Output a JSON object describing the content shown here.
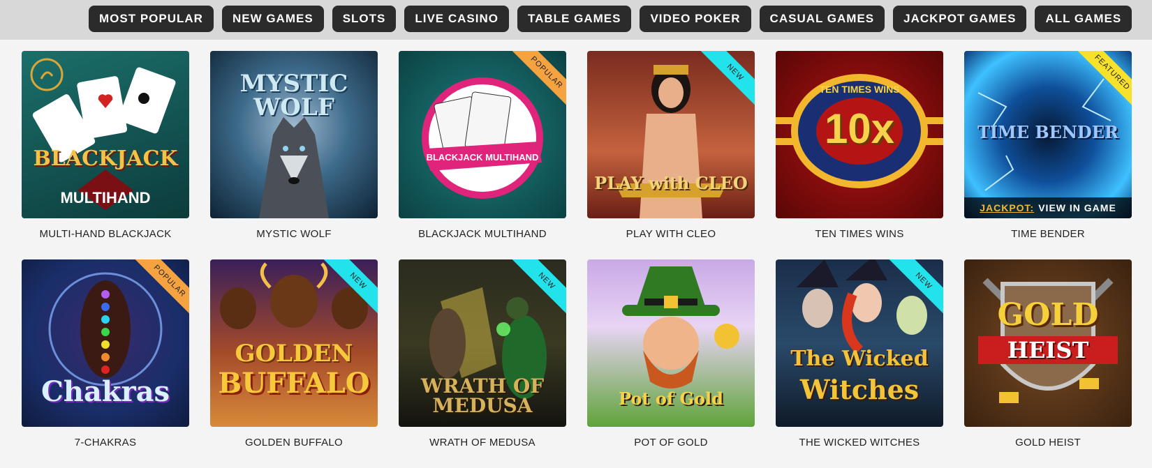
{
  "nav": [
    {
      "label": "MOST POPULAR"
    },
    {
      "label": "NEW GAMES"
    },
    {
      "label": "SLOTS"
    },
    {
      "label": "LIVE CASINO"
    },
    {
      "label": "TABLE GAMES"
    },
    {
      "label": "VIDEO POKER"
    },
    {
      "label": "CASUAL GAMES"
    },
    {
      "label": "JACKPOT GAMES"
    },
    {
      "label": "ALL GAMES"
    }
  ],
  "games": [
    {
      "name": "MULTI-HAND BLACKJACK",
      "art": "BLACKJACK",
      "art_sub": "MULTIHAND"
    },
    {
      "name": "MYSTIC WOLF",
      "art": "MYSTIC WOLF"
    },
    {
      "name": "BLACKJACK MULTIHAND",
      "art": "BLACKJACK MULTIHAND",
      "ribbon": "POPULAR"
    },
    {
      "name": "PLAY WITH CLEO",
      "art": "PLAY with CLEO",
      "ribbon": "NEW"
    },
    {
      "name": "TEN TIMES WINS",
      "art": "10x",
      "art_sub": "TEN TIMES WINS"
    },
    {
      "name": "TIME BENDER",
      "art": "TIME BENDER",
      "ribbon": "FEATURED",
      "jackpot_label": "JACKPOT:",
      "jackpot_value": "VIEW IN GAME"
    },
    {
      "name": "7-CHAKRAS",
      "art": "Chakras",
      "ribbon": "POPULAR"
    },
    {
      "name": "GOLDEN BUFFALO",
      "art": "GOLDEN",
      "art_sub": "BUFFALO",
      "ribbon": "NEW"
    },
    {
      "name": "WRATH OF MEDUSA",
      "art": "WRATH OF MEDUSA",
      "ribbon": "NEW"
    },
    {
      "name": "POT OF GOLD",
      "art": "Pot of Gold"
    },
    {
      "name": "THE WICKED WITCHES",
      "art": "The Wicked",
      "art_sub": "Witches",
      "ribbon": "NEW"
    },
    {
      "name": "GOLD HEIST",
      "art": "GOLD",
      "art_sub": "HEIST"
    }
  ],
  "colors": {
    "ribbon_popular": "#f5a340",
    "ribbon_new": "#22e3ec",
    "ribbon_featured": "#f7e12a",
    "jackpot_accent": "#f5b633"
  }
}
